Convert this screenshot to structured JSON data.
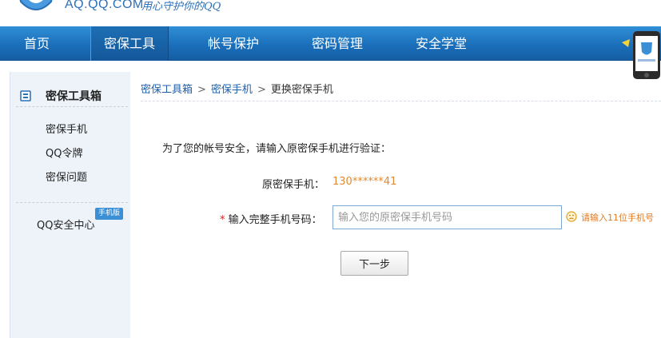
{
  "header": {
    "domain": "AQ.QQ.COM",
    "slogan": "用心守护你的QQ"
  },
  "nav": {
    "items": [
      {
        "label": "首页"
      },
      {
        "label": "密保工具"
      },
      {
        "label": "帐号保护"
      },
      {
        "label": "密码管理"
      },
      {
        "label": "安全学堂"
      }
    ],
    "active_index": 1
  },
  "sidebar": {
    "title": "密保工具箱",
    "links": [
      "密保手机",
      "QQ令牌",
      "密保问题"
    ],
    "security_center": "QQ安全中心",
    "badge": "手机版"
  },
  "breadcrumb": [
    "密保工具箱",
    "密保手机",
    "更换密保手机"
  ],
  "form": {
    "intro": "为了您的帐号安全，请输入原密保手机进行验证：",
    "phone_label": "原密保手机：",
    "phone_value": "130******41",
    "input_label": "输入完整手机号码：",
    "input_placeholder": "输入您的原密保手机号码",
    "hint": "请输入11位手机号",
    "next_button": "下一步"
  },
  "colors": {
    "nav_blue": "#1a6db8",
    "accent_orange": "#e08a35",
    "link_blue": "#1f5fa8"
  }
}
